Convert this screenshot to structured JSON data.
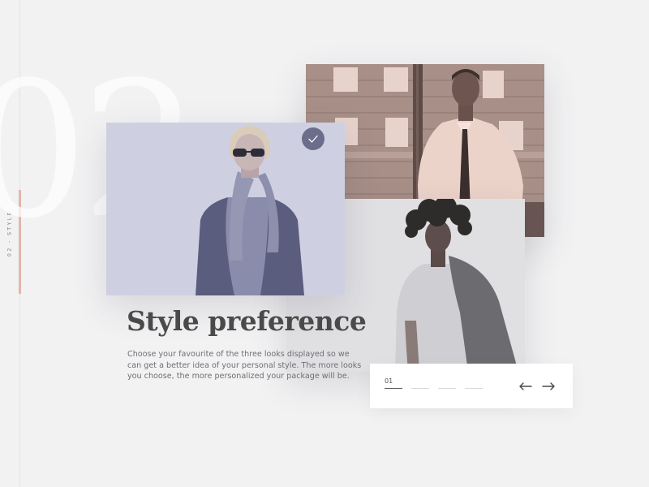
{
  "sidebar": {
    "section_label": "02 - STYLE"
  },
  "background_number": "02",
  "looks": [
    {
      "name": "look-1",
      "selected": true,
      "tint": "#c9cbe0",
      "icon": "check-icon"
    },
    {
      "name": "look-2",
      "selected": false,
      "tint": "#e9c2b8"
    },
    {
      "name": "look-3",
      "selected": false,
      "tint": "#e0e0e3"
    }
  ],
  "content": {
    "title": "Style preference",
    "description": "Choose your favourite of the three looks displayed so we can get a better idea of your personal style. The more looks you choose, the more personalized your package will be."
  },
  "pager": {
    "current_page": "01",
    "total_steps": 4,
    "active_step": 1,
    "prev_icon": "arrow-left-icon",
    "next_icon": "arrow-right-icon"
  },
  "colors": {
    "accent": "#e2b6ad",
    "check_badge": "#6c6d8a",
    "text_dark": "#4a4a4a",
    "text_body": "#6e6e75"
  }
}
